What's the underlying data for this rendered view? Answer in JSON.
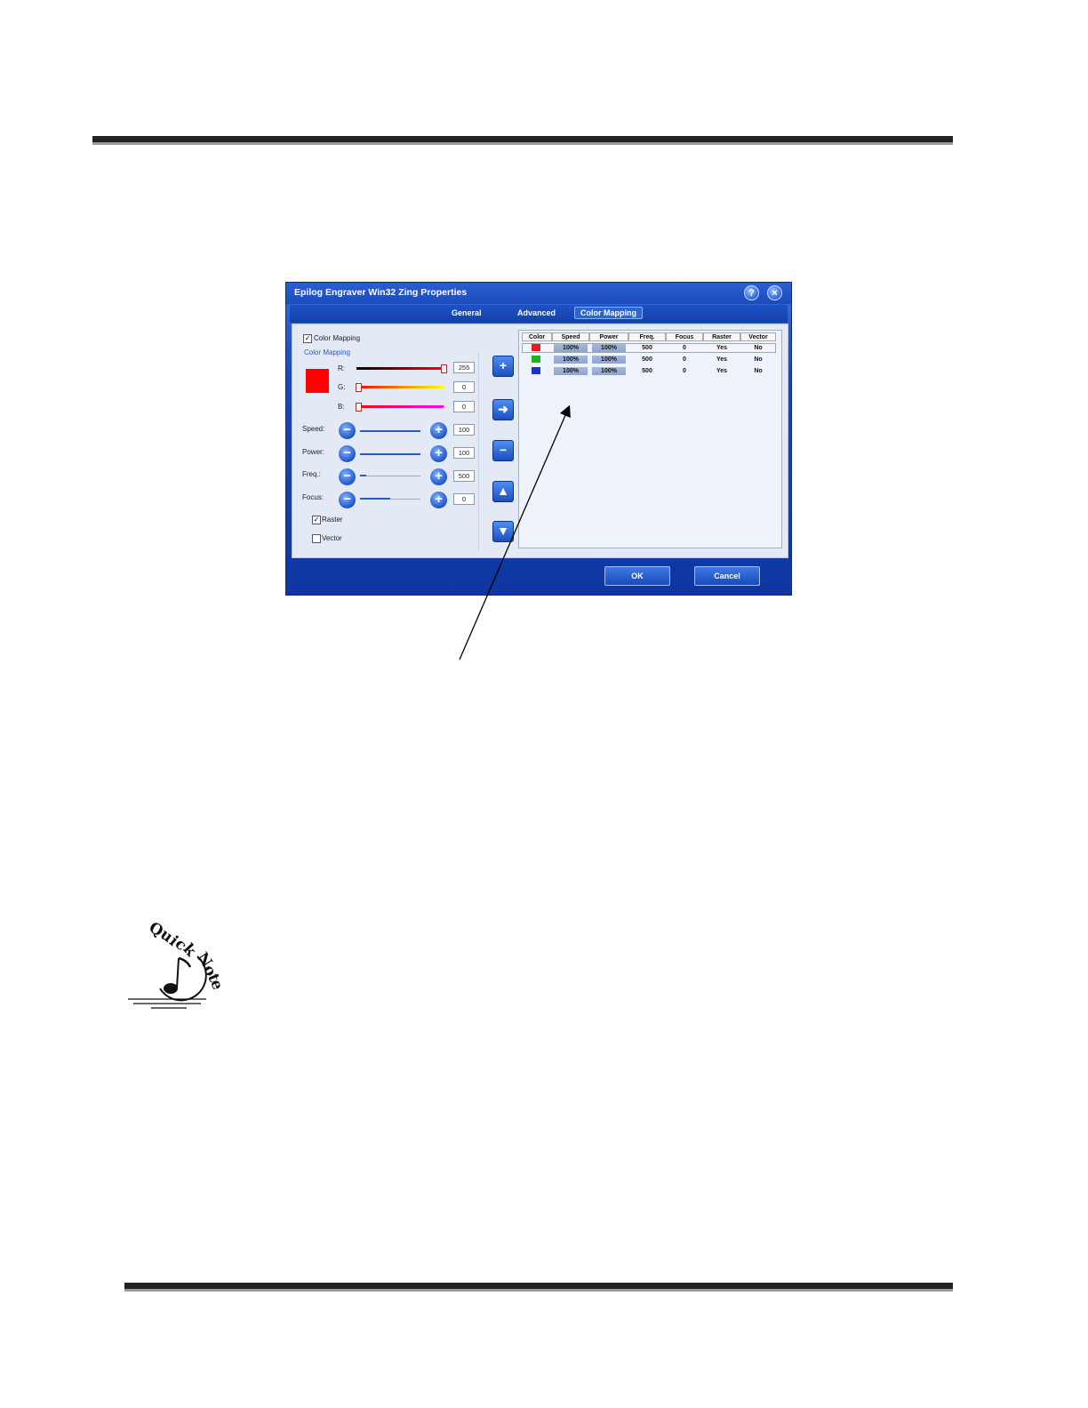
{
  "dialog": {
    "title": "Epilog Engraver Win32 Zing Properties",
    "help_icon": "?",
    "close_icon": "×",
    "tabs": [
      "General",
      "Advanced",
      "Color Mapping"
    ],
    "active_tab": "Color Mapping",
    "left": {
      "color_mapping_checkbox": "Color Mapping",
      "group_label": "Color Mapping",
      "r_label": "R:",
      "g_label": "G:",
      "b_label": "B:",
      "r_value": "255",
      "g_value": "0",
      "b_value": "0",
      "speed_label": "Speed:",
      "power_label": "Power:",
      "freq_label": "Freq.:",
      "focus_label": "Focus:",
      "speed_value": "100",
      "power_value": "100",
      "freq_value": "500",
      "focus_value": "0",
      "raster_label": "Raster",
      "vector_label": "Vector",
      "raster_checked": true,
      "vector_checked": false,
      "swatch_color": "#ff0000"
    },
    "table": {
      "headers": [
        "Color",
        "Speed",
        "Power",
        "Freq.",
        "Focus",
        "Raster",
        "Vector"
      ],
      "rows": [
        {
          "color": "#e02020",
          "speed": "100%",
          "power": "100%",
          "freq": "500",
          "focus": "0",
          "raster": "Yes",
          "vector": "No"
        },
        {
          "color": "#20b020",
          "speed": "100%",
          "power": "100%",
          "freq": "500",
          "focus": "0",
          "raster": "Yes",
          "vector": "No"
        },
        {
          "color": "#2030d0",
          "speed": "100%",
          "power": "100%",
          "freq": "500",
          "focus": "0",
          "raster": "Yes",
          "vector": "No"
        }
      ]
    },
    "ok_label": "OK",
    "cancel_label": "Cancel"
  },
  "quick_note": {
    "letters": [
      "Q",
      "u",
      "i",
      "c",
      "k",
      " ",
      "N",
      "o",
      "t",
      "e"
    ],
    "icon": "musical-note-icon"
  }
}
